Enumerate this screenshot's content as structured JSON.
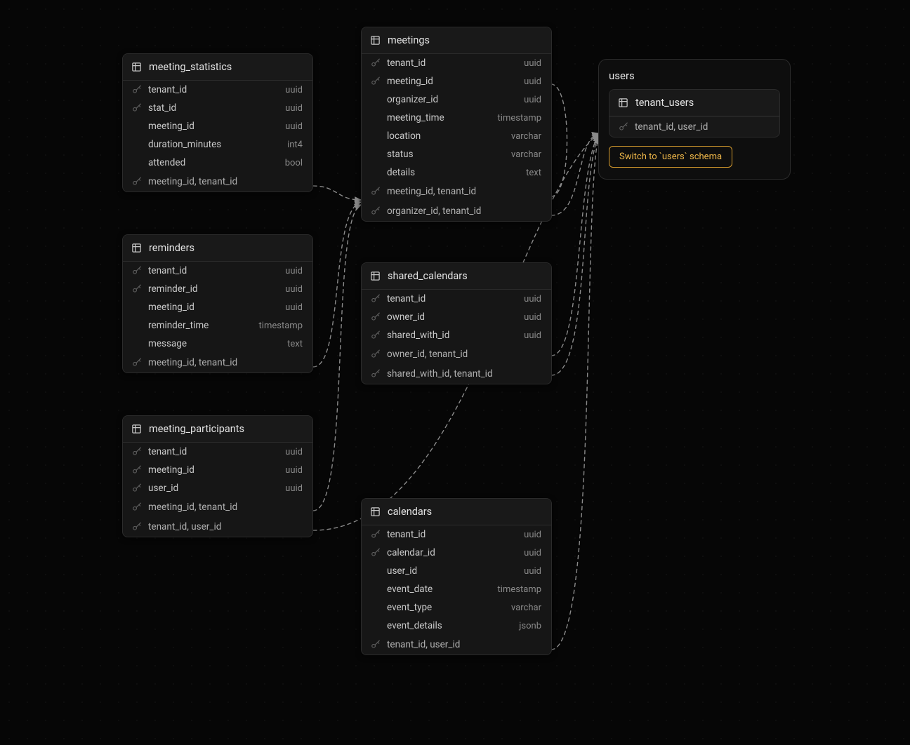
{
  "schema_box": {
    "title": "users",
    "switch_label": "Switch to `users` schema"
  },
  "tables": {
    "meeting_statistics": {
      "title": "meeting_statistics",
      "cols": [
        {
          "name": "tenant_id",
          "type": "uuid",
          "key": true
        },
        {
          "name": "stat_id",
          "type": "uuid",
          "key": true
        },
        {
          "name": "meeting_id",
          "type": "uuid",
          "key": false
        },
        {
          "name": "duration_minutes",
          "type": "int4",
          "key": false
        },
        {
          "name": "attended",
          "type": "bool",
          "key": false
        }
      ],
      "fks": [
        {
          "label": "meeting_id, tenant_id"
        }
      ]
    },
    "reminders": {
      "title": "reminders",
      "cols": [
        {
          "name": "tenant_id",
          "type": "uuid",
          "key": true
        },
        {
          "name": "reminder_id",
          "type": "uuid",
          "key": true
        },
        {
          "name": "meeting_id",
          "type": "uuid",
          "key": false
        },
        {
          "name": "reminder_time",
          "type": "timestamp",
          "key": false
        },
        {
          "name": "message",
          "type": "text",
          "key": false
        }
      ],
      "fks": [
        {
          "label": "meeting_id, tenant_id"
        }
      ]
    },
    "meeting_participants": {
      "title": "meeting_participants",
      "cols": [
        {
          "name": "tenant_id",
          "type": "uuid",
          "key": true
        },
        {
          "name": "meeting_id",
          "type": "uuid",
          "key": true
        },
        {
          "name": "user_id",
          "type": "uuid",
          "key": true
        }
      ],
      "fks": [
        {
          "label": "meeting_id, tenant_id"
        },
        {
          "label": "tenant_id, user_id"
        }
      ]
    },
    "meetings": {
      "title": "meetings",
      "cols": [
        {
          "name": "tenant_id",
          "type": "uuid",
          "key": true
        },
        {
          "name": "meeting_id",
          "type": "uuid",
          "key": true
        },
        {
          "name": "organizer_id",
          "type": "uuid",
          "key": false
        },
        {
          "name": "meeting_time",
          "type": "timestamp",
          "key": false
        },
        {
          "name": "location",
          "type": "varchar",
          "key": false
        },
        {
          "name": "status",
          "type": "varchar",
          "key": false
        },
        {
          "name": "details",
          "type": "text",
          "key": false
        }
      ],
      "fks": [
        {
          "label": "meeting_id, tenant_id"
        },
        {
          "label": "organizer_id, tenant_id"
        }
      ]
    },
    "shared_calendars": {
      "title": "shared_calendars",
      "cols": [
        {
          "name": "tenant_id",
          "type": "uuid",
          "key": true
        },
        {
          "name": "owner_id",
          "type": "uuid",
          "key": true
        },
        {
          "name": "shared_with_id",
          "type": "uuid",
          "key": true
        }
      ],
      "fks": [
        {
          "label": "owner_id, tenant_id"
        },
        {
          "label": "shared_with_id, tenant_id"
        }
      ]
    },
    "calendars": {
      "title": "calendars",
      "cols": [
        {
          "name": "tenant_id",
          "type": "uuid",
          "key": true
        },
        {
          "name": "calendar_id",
          "type": "uuid",
          "key": true
        },
        {
          "name": "user_id",
          "type": "uuid",
          "key": false
        },
        {
          "name": "event_date",
          "type": "timestamp",
          "key": false
        },
        {
          "name": "event_type",
          "type": "varchar",
          "key": false
        },
        {
          "name": "event_details",
          "type": "jsonb",
          "key": false
        }
      ],
      "fks": [
        {
          "label": "tenant_id, user_id"
        }
      ]
    },
    "tenant_users": {
      "title": "tenant_users",
      "cols": [],
      "fks": [
        {
          "label": "tenant_id, user_id"
        }
      ]
    }
  }
}
